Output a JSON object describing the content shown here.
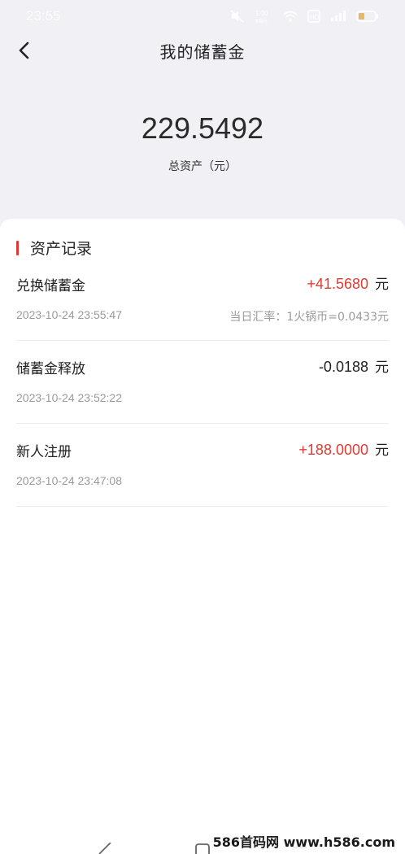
{
  "status_bar": {
    "time": "23:55",
    "network_speed": "1.00\nKB/s"
  },
  "header": {
    "title": "我的储蓄金",
    "back_icon": "chevron-left-icon"
  },
  "summary": {
    "total": "229.5492",
    "label": "总资产（元）"
  },
  "section": {
    "title": "资产记录",
    "accent_color": "#e03a33"
  },
  "records": [
    {
      "name": "兑换储蓄金",
      "amount": "+41.5680",
      "unit": "元",
      "time": "2023-10-24 23:55:47",
      "note": "当日汇率：1火锅币=0.0433元",
      "amount_color": "#e03a33"
    },
    {
      "name": "储蓄金释放",
      "amount": "-0.0188",
      "unit": "元",
      "time": "2023-10-24 23:52:22",
      "note": "",
      "amount_color": "#222222"
    },
    {
      "name": "新人注册",
      "amount": "+188.0000",
      "unit": "元",
      "time": "2023-10-24 23:47:08",
      "note": "",
      "amount_color": "#e03a33"
    }
  ],
  "watermark": "586首码网 www.h586.com"
}
